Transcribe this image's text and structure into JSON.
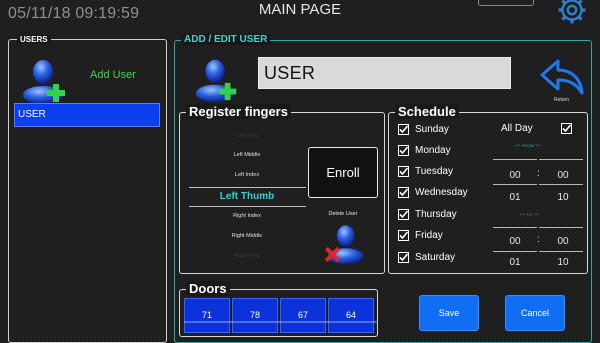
{
  "header": {
    "datetime": "05/11/18 09:19:59",
    "title": "MAIN PAGE",
    "settings_icon": "gear-icon"
  },
  "users": {
    "legend": "USERS",
    "add_user_label": "Add User",
    "list": [
      {
        "name": "USER",
        "selected": true
      }
    ]
  },
  "edit": {
    "legend": "ADD / EDIT USER",
    "username": "USER",
    "return_label": "Return"
  },
  "fingers": {
    "legend": "Register fingers",
    "items": [
      {
        "label": "Left Ring",
        "state": "faded"
      },
      {
        "label": "Left Middle",
        "state": "normal"
      },
      {
        "label": "Left Index",
        "state": "normal"
      },
      {
        "label": "Left Thumb",
        "state": "selected"
      },
      {
        "label": "Right Index",
        "state": "normal"
      },
      {
        "label": "Right Middle",
        "state": "normal"
      },
      {
        "label": "Right Ring",
        "state": "faded"
      }
    ],
    "enroll_label": "Enroll",
    "delete_user_label": "Delete User"
  },
  "schedule": {
    "legend": "Schedule",
    "days": [
      {
        "label": "Sunday",
        "checked": true
      },
      {
        "label": "Monday",
        "checked": true
      },
      {
        "label": "Tuesday",
        "checked": true
      },
      {
        "label": "Wednesday",
        "checked": true
      },
      {
        "label": "Thursday",
        "checked": true
      },
      {
        "label": "Friday",
        "checked": true
      },
      {
        "label": "Saturday",
        "checked": true
      }
    ],
    "all_day_label": "All Day",
    "all_day_checked": true,
    "from_label": "*** FROM ***",
    "to_label": "*** TO ***",
    "from_time": {
      "hour": "00",
      "minute": "00"
    },
    "from_time_2": {
      "hour": "01",
      "minute": "10"
    },
    "to_time": {
      "hour": "00",
      "minute": "00"
    },
    "to_time_2": {
      "hour": "01",
      "minute": "10"
    },
    "separator": ":"
  },
  "doors": {
    "legend": "Doors",
    "items": [
      "71",
      "78",
      "67",
      "64"
    ]
  },
  "actions": {
    "save_label": "Save",
    "cancel_label": "Cancel"
  },
  "colors": {
    "accent_teal": "#2fa8a3",
    "list_selected": "#0b3ff0",
    "door_blue": "#0b33d9",
    "button_blue": "#0f6ef3",
    "add_green": "#38d84a",
    "return_blue": "#1e78f0"
  }
}
